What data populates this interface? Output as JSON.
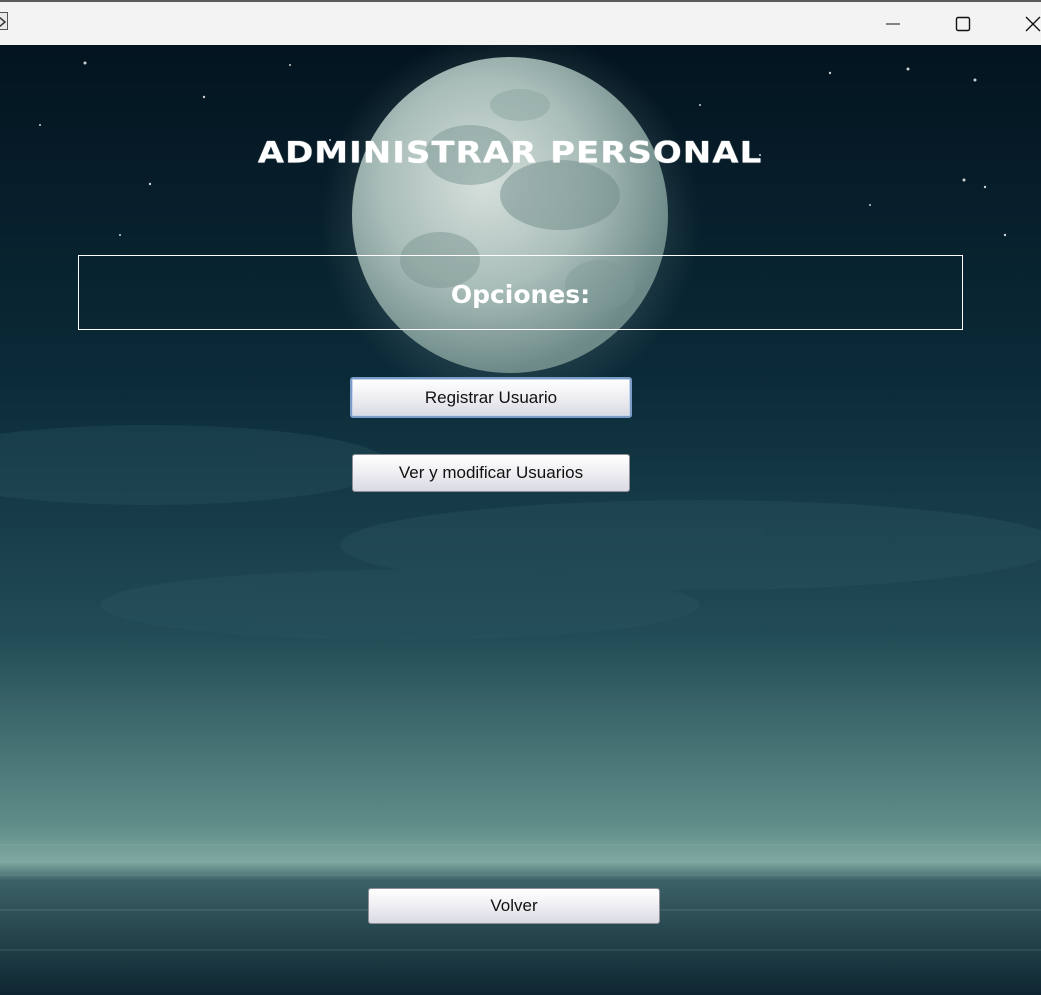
{
  "window": {
    "title": "",
    "controls": {
      "minimize_icon": "minimize-icon",
      "maximize_icon": "maximize-icon",
      "close_icon": "close-icon"
    }
  },
  "main": {
    "heading": "ADMINISTRAR PERSONAL",
    "options_label": "Opciones:",
    "buttons": {
      "register_user": "Registrar Usuario",
      "view_modify_users": "Ver y modificar Usuarios",
      "back": "Volver"
    }
  },
  "colors": {
    "sky_dark": "#061a26",
    "sea": "#2f5b5e",
    "horizon_glow": "#7fa8a0",
    "moon": "#b8c8c4",
    "text_light": "#ffffff"
  }
}
